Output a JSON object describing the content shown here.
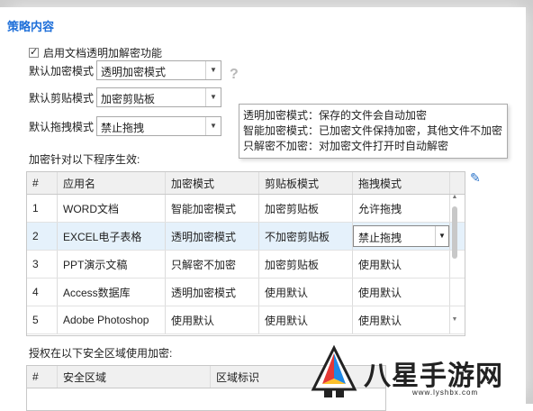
{
  "section_title": "策略内容",
  "enable_checkbox": {
    "label": "启用文档透明加解密功能",
    "checked": true
  },
  "settings": {
    "encrypt_mode": {
      "label": "默认加密模式",
      "value": "透明加密模式"
    },
    "clipboard_mode": {
      "label": "默认剪贴模式",
      "value": "加密剪贴板"
    },
    "drag_mode": {
      "label": "默认拖拽模式",
      "value": "禁止拖拽"
    }
  },
  "help_icon": "?",
  "tooltip": {
    "lines": [
      "透明加密模式：保存的文件会自动加密",
      "智能加密模式：已加密文件保持加密，其他文件不加密",
      "只解密不加密：对加密文件打开时自动解密"
    ]
  },
  "program_table": {
    "label": "加密针对以下程序生效:",
    "columns": [
      "#",
      "应用名",
      "加密模式",
      "剪贴板模式",
      "拖拽模式"
    ],
    "rows": [
      [
        "1",
        "WORD文档",
        "智能加密模式",
        "加密剪贴板",
        "允许拖拽"
      ],
      [
        "2",
        "EXCEL电子表格",
        "透明加密模式",
        "不加密剪贴板",
        "禁止拖拽"
      ],
      [
        "3",
        "PPT演示文稿",
        "只解密不加密",
        "加密剪贴板",
        "使用默认"
      ],
      [
        "4",
        "Access数据库",
        "透明加密模式",
        "使用默认",
        "使用默认"
      ],
      [
        "5",
        "Adobe Photoshop",
        "使用默认",
        "使用默认",
        "使用默认"
      ]
    ],
    "selected_row": 1
  },
  "zone_table": {
    "label": "授权在以下安全区域使用加密:",
    "columns": [
      "#",
      "安全区域",
      "区域标识"
    ]
  },
  "watermark": {
    "brand": "八星手游网",
    "url": "www.lyshbx.com"
  },
  "icons": {
    "edit": "pencil-icon",
    "dropdown": "chevron-down-icon"
  }
}
